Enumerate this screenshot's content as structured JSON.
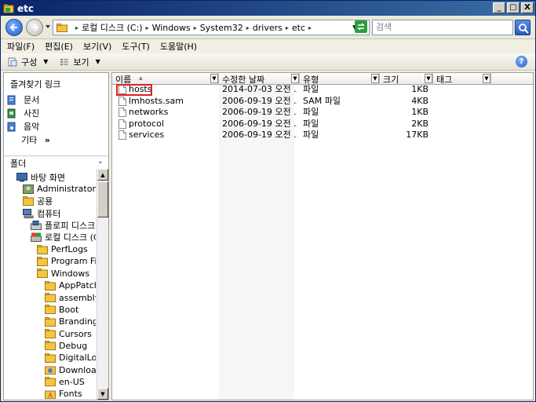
{
  "window": {
    "title": "etc",
    "minimize_label": "_",
    "maximize_label": "□",
    "close_label": "X"
  },
  "address": {
    "path": [
      "로컬 디스크 (C:)",
      "Windows",
      "System32",
      "drivers",
      "etc"
    ],
    "search_placeholder": "검색"
  },
  "menu": {
    "items": [
      "파일(F)",
      "편집(E)",
      "보기(V)",
      "도구(T)",
      "도움말(H)"
    ]
  },
  "toolbar": {
    "organize": "구성",
    "view": "보기"
  },
  "favorites": {
    "title": "즐겨찾기 링크",
    "items": [
      "문서",
      "사진",
      "음악"
    ],
    "more": "기타",
    "more_arrow": "»"
  },
  "folders": {
    "title": "폴더",
    "tree": [
      {
        "label": "바탕 화면",
        "level": 1,
        "icon": "desktop"
      },
      {
        "label": "Administrator",
        "level": 2,
        "icon": "user"
      },
      {
        "label": "공용",
        "level": 2,
        "icon": "folder"
      },
      {
        "label": "컴퓨터",
        "level": 2,
        "icon": "computer"
      },
      {
        "label": "플로피 디스크",
        "level": 3,
        "icon": "floppy"
      },
      {
        "label": "로컬 디스크 (C",
        "level": 3,
        "icon": "drive"
      },
      {
        "label": "PerfLogs",
        "level": 4,
        "icon": "folder"
      },
      {
        "label": "Program File",
        "level": 4,
        "icon": "folder"
      },
      {
        "label": "Windows",
        "level": 4,
        "icon": "folder"
      },
      {
        "label": "AppPatch",
        "level": 5,
        "icon": "folder"
      },
      {
        "label": "assembly",
        "level": 5,
        "icon": "folder"
      },
      {
        "label": "Boot",
        "level": 5,
        "icon": "folder"
      },
      {
        "label": "Branding",
        "level": 5,
        "icon": "folder"
      },
      {
        "label": "Cursors",
        "level": 5,
        "icon": "folder"
      },
      {
        "label": "Debug",
        "level": 5,
        "icon": "folder"
      },
      {
        "label": "DigitalLock",
        "level": 5,
        "icon": "folder"
      },
      {
        "label": "Downloade",
        "level": 5,
        "icon": "download-folder"
      },
      {
        "label": "en-US",
        "level": 5,
        "icon": "folder"
      },
      {
        "label": "Fonts",
        "level": 5,
        "icon": "fonts-folder"
      }
    ]
  },
  "filelist": {
    "columns": [
      "이름",
      "수정한 날짜",
      "유형",
      "크기",
      "태그"
    ],
    "rows": [
      {
        "name": "hosts",
        "date": "2014-07-03 오전 ...",
        "type": "파일",
        "size": "1KB",
        "highlighted": true
      },
      {
        "name": "lmhosts.sam",
        "date": "2006-09-19 오전 ...",
        "type": "SAM 파일",
        "size": "4KB",
        "highlighted": false
      },
      {
        "name": "networks",
        "date": "2006-09-19 오전 ...",
        "type": "파일",
        "size": "1KB",
        "highlighted": false
      },
      {
        "name": "protocol",
        "date": "2006-09-19 오전 ...",
        "type": "파일",
        "size": "2KB",
        "highlighted": false
      },
      {
        "name": "services",
        "date": "2006-09-19 오전 ...",
        "type": "파일",
        "size": "17KB",
        "highlighted": false
      }
    ]
  },
  "colors": {
    "highlight_border": "#e02020",
    "folder_yellow": "#f5c542"
  }
}
